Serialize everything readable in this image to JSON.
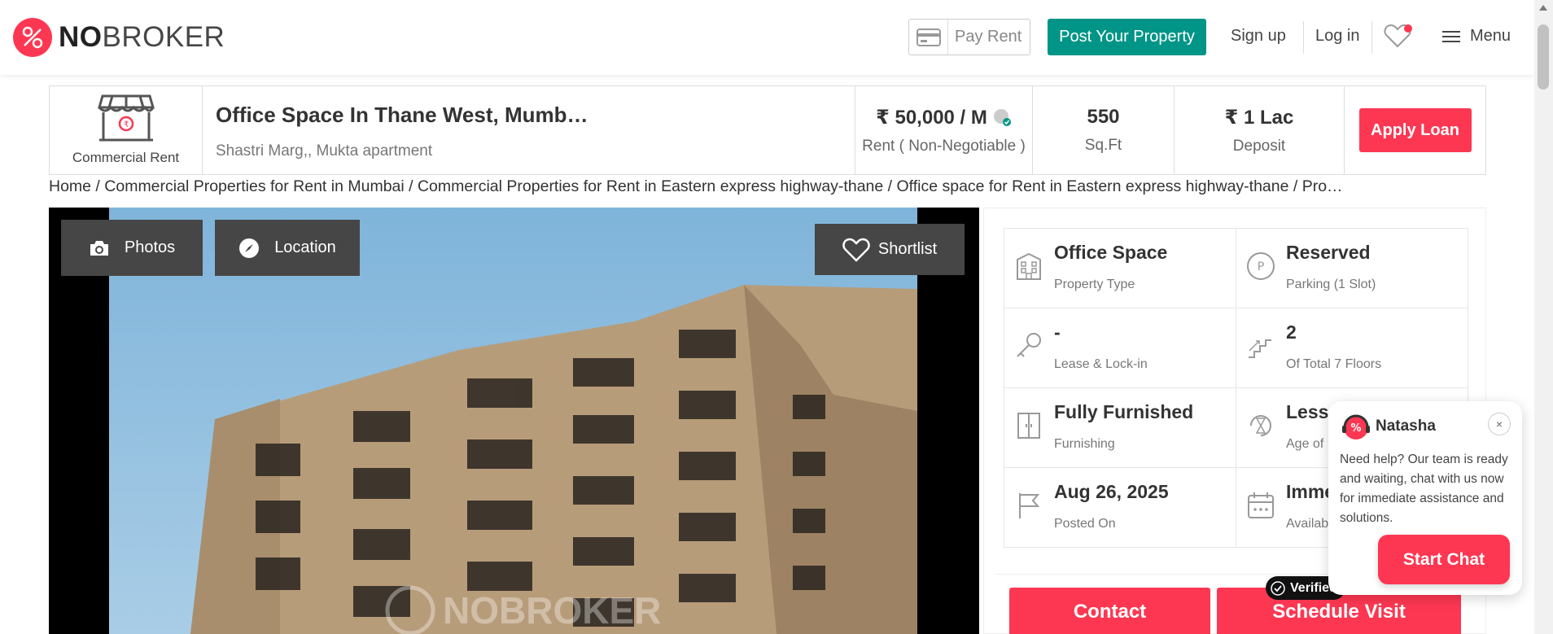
{
  "brand": {
    "logo_bold": "NO",
    "logo_rest": "BROKER",
    "red": "#fd3752",
    "teal": "#009587"
  },
  "header": {
    "pay_rent": "Pay Rent",
    "post_property": "Post Your Property",
    "sign_up": "Sign up",
    "log_in": "Log in",
    "menu": "Menu"
  },
  "summary": {
    "type_caption": "Commercial Rent",
    "title": "Office Space In Thane West, Mumb…",
    "address": "Shastri Marg,, Mukta apartment",
    "rent_value": "₹ 50,000 / M",
    "rent_label": "Rent ( Non-Negotiable )",
    "area_value": "550",
    "area_label": "Sq.Ft",
    "deposit_value": "₹ 1 Lac",
    "deposit_label": "Deposit",
    "apply_loan": "Apply Loan"
  },
  "breadcrumb": "Home / Commercial Properties for Rent in Mumbai / Commercial Properties for Rent in Eastern express highway-thane / Office space for Rent in Eastern express highway-thane / Pro…",
  "photo": {
    "photos_btn": "Photos",
    "location_btn": "Location",
    "shortlist_btn": "Shortlist",
    "watermark": "NOBROKER"
  },
  "details": [
    {
      "value": "Office Space",
      "label": "Property Type",
      "icon": "building-icon"
    },
    {
      "value": "Reserved",
      "label": "Parking  (1 Slot)",
      "icon": "parking-icon"
    },
    {
      "value": "-",
      "label": "Lease & Lock-in",
      "icon": "key-icon"
    },
    {
      "value": "2",
      "label": "Of Total 7 Floors",
      "icon": "stairs-icon"
    },
    {
      "value": "Fully Furnished",
      "label": "Furnishing",
      "icon": "cupboard-icon"
    },
    {
      "value": "Less T",
      "label": "Age of I",
      "icon": "hourglass-icon"
    },
    {
      "value": "Aug 26, 2025",
      "label": "Posted On",
      "icon": "flag-icon"
    },
    {
      "value": "Imme",
      "label": "Availab",
      "icon": "calendar-icon"
    }
  ],
  "actions": {
    "contact": "Contact",
    "schedule": "Schedule Visit",
    "verified": "Verified"
  },
  "chat": {
    "agent_name": "Natasha",
    "close": "×",
    "message": "Need help? Our team is ready and waiting, chat with us now for immediate assistance and solutions.",
    "start_chat": "Start Chat"
  }
}
